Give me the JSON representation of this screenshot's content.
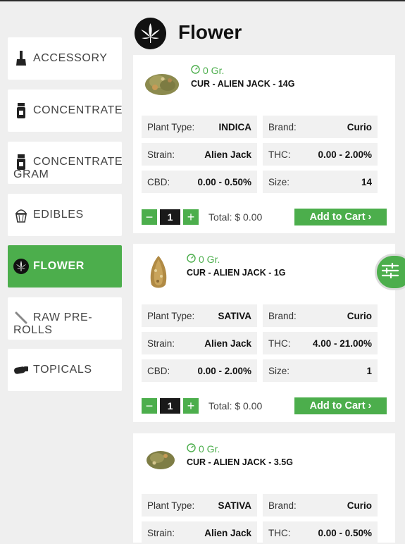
{
  "page": {
    "title": "Flower"
  },
  "categories": [
    {
      "label": "ACCESSORY",
      "icon": "bong-icon"
    },
    {
      "label": "CONCENTRATE",
      "icon": "jar-icon"
    },
    {
      "label_line1": "CONCENTRATE",
      "label_line2": "GRAM",
      "icon": "jar-icon"
    },
    {
      "label": "EDIBLES",
      "icon": "cupcake-icon"
    },
    {
      "label": "FLOWER",
      "icon": "leaf-icon",
      "active": true
    },
    {
      "label_line1": "RAW PRE-",
      "label_line2": "ROLLS",
      "icon": "joint-icon"
    },
    {
      "label": "TOPICALS",
      "icon": "tube-icon"
    }
  ],
  "labels": {
    "plant_type": "Plant Type:",
    "brand": "Brand:",
    "strain": "Strain:",
    "thc": "THC:",
    "cbd": "CBD:",
    "size": "Size:",
    "total": "Total: $ 0.00",
    "add_to_cart": "Add to Cart ›",
    "minus": "−",
    "plus": "+"
  },
  "products": [
    {
      "stock": "0 Gr.",
      "name": "CUR - ALIEN JACK - 14G",
      "plant_type": "INDICA",
      "brand": "Curio",
      "strain": "Alien Jack",
      "thc": "0.00 - 2.00%",
      "cbd": "0.00 - 0.50%",
      "size": "14",
      "qty": "1"
    },
    {
      "stock": "0 Gr.",
      "name": "CUR - ALIEN JACK - 1G",
      "plant_type": "SATIVA",
      "brand": "Curio",
      "strain": "Alien Jack",
      "thc": "4.00 - 21.00%",
      "cbd": "0.00 - 2.00%",
      "size": "1",
      "qty": "1"
    },
    {
      "stock": "0 Gr.",
      "name": "CUR - ALIEN JACK - 3.5G",
      "plant_type": "SATIVA",
      "brand": "Curio",
      "strain": "Alien Jack",
      "thc": "0.00 - 0.50%"
    }
  ],
  "colors": {
    "accent": "#4cae4c",
    "background": "#efefef",
    "card": "#ffffff",
    "cell": "#f1f1f1"
  }
}
